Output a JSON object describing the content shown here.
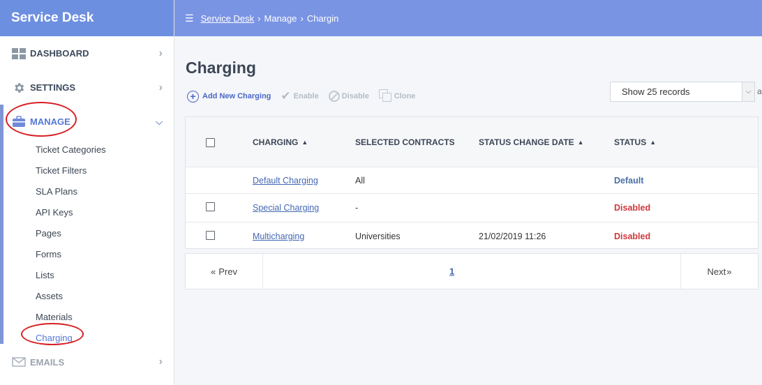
{
  "sidebar": {
    "brand": "Service Desk",
    "nav": [
      {
        "label": "DASHBOARD"
      },
      {
        "label": "SETTINGS"
      },
      {
        "label": "MANAGE"
      }
    ],
    "sub_items": [
      "Ticket Categories",
      "Ticket Filters",
      "SLA Plans",
      "API Keys",
      "Pages",
      "Forms",
      "Lists",
      "Assets",
      "Materials",
      "Charging"
    ],
    "emails_label": "EMAILS"
  },
  "breadcrumb": {
    "root": "Service Desk",
    "level2": "Manage",
    "level3": "Chargin"
  },
  "page": {
    "title": "Charging"
  },
  "toolbar": {
    "add": "Add New Charging",
    "enable": "Enable",
    "disable": "Disable",
    "clone": "Clone"
  },
  "records": {
    "selected": "Show 25 records",
    "cut_text": "a"
  },
  "table": {
    "headers": {
      "charging": "CHARGING",
      "contracts": "SELECTED CONTRACTS",
      "date": "STATUS CHANGE DATE",
      "status": "STATUS"
    },
    "rows": [
      {
        "name": "Default Charging",
        "contracts": "All",
        "date": "",
        "status": "Default"
      },
      {
        "name": "Special Charging",
        "contracts": "-",
        "date": "",
        "status": "Disabled"
      },
      {
        "name": "Multicharging",
        "contracts": "Universities",
        "date": "21/02/2019 11:26",
        "status": "Disabled"
      }
    ]
  },
  "pager": {
    "prev": "Prev",
    "page": "1",
    "next": "Next"
  },
  "colors": {
    "brand": "#6d8fe0",
    "topbar": "#7a94e4",
    "accent": "#5577d8",
    "disabled": "#d0383c",
    "annotation": "#d62024"
  }
}
